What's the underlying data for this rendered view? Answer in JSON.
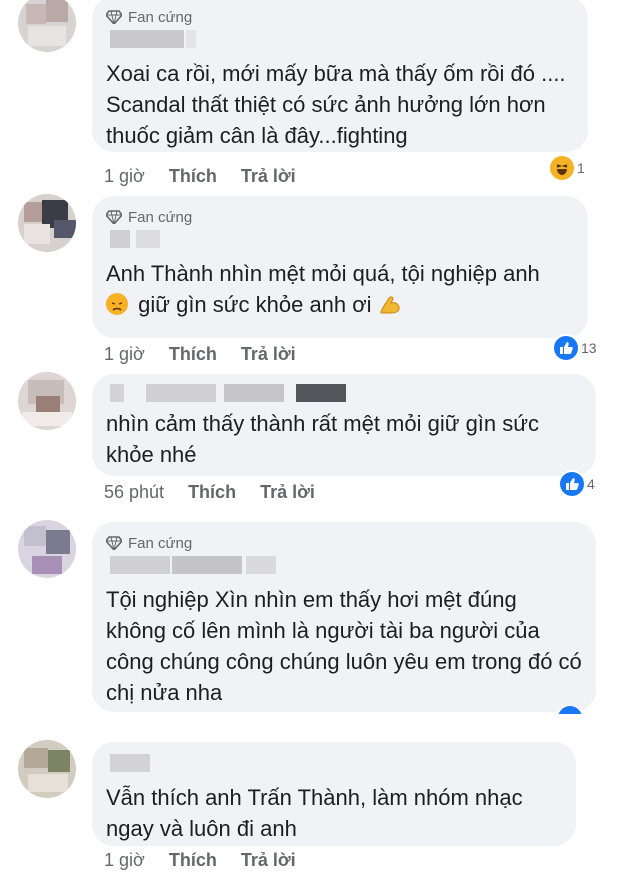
{
  "comments": [
    {
      "badge": "Fan cứng",
      "text": "Xoai ca rồi, mới mấy bữa mà thấy ốm rồi đó ....  Scandal thất thiệt có sức ảnh hưởng lớn hơn thuốc  giảm cân là đây...fighting",
      "time": "1 giờ",
      "like": "Thích",
      "reply": "Trả lời",
      "reaction_count": "1",
      "reaction_icon": "haha-emoji-icon"
    },
    {
      "badge": "Fan cứng",
      "text_before": "Anh Thành nhìn mệt mỏi quá, tội nghiệp anh",
      "text_after": "giữ gìn sức khỏe anh ơi",
      "time": "1 giờ",
      "like": "Thích",
      "reply": "Trả lời",
      "reaction_count": "13",
      "reaction_icon": "like-icon"
    },
    {
      "text": "nhìn cảm thấy thành rất mệt mỏi giữ gìn sức khỏe nhé",
      "time": "56 phút",
      "like": "Thích",
      "reply": "Trả lời",
      "reaction_count": "4",
      "reaction_icon": "like-icon"
    },
    {
      "badge": "Fan cứng",
      "text": "Tội nghiệp Xìn nhìn em thấy hơi mệt đúng không cố lên mình là người tài ba người của công chúng công chúng luôn yêu em trong đó có chị nửa nha",
      "reaction_icon": "like-icon"
    },
    {
      "text": "Vẫn thích anh Trấn Thành, làm nhóm nhạc ngay và luôn đi anh",
      "time": "1 giờ",
      "like": "Thích",
      "reply": "Trả lời"
    }
  ],
  "colors": {
    "bubble": "#f0f2f5",
    "meta": "#65676b",
    "like_blue": "#1877f2",
    "haha_yellow": "#f7b125"
  }
}
